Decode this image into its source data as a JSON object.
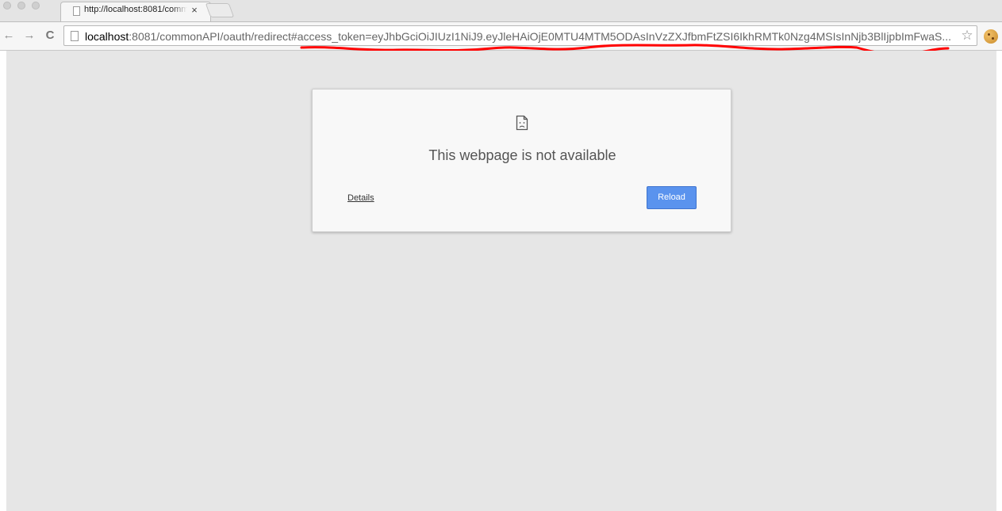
{
  "tab": {
    "title": "http://localhost:8081/comm",
    "close_glyph": "×"
  },
  "toolbar": {
    "back_glyph": "←",
    "forward_glyph": "→",
    "reload_glyph": "C"
  },
  "omnibox": {
    "url_host": "localhost",
    "url_rest": ":8081/commonAPI/oauth/redirect#access_token=eyJhbGciOiJIUzI1NiJ9.eyJleHAiOjE0MTU4MTM5ODAsInVzZXJfbmFtZSI6IkhRMTk0Nzg4MSIsInNjb3BlIjpbImFwaS...",
    "star_glyph": "☆"
  },
  "icons": {
    "page": "page-icon",
    "sad_page": "sad-page-icon",
    "star": "star-icon",
    "extension": "cookie-extension-icon"
  },
  "colors": {
    "annotation": "#ff0000",
    "reload_button": "#5a93ee",
    "page_background": "#e6e6e6"
  },
  "error": {
    "title": "This webpage is not available",
    "details_label": "Details",
    "reload_label": "Reload"
  }
}
